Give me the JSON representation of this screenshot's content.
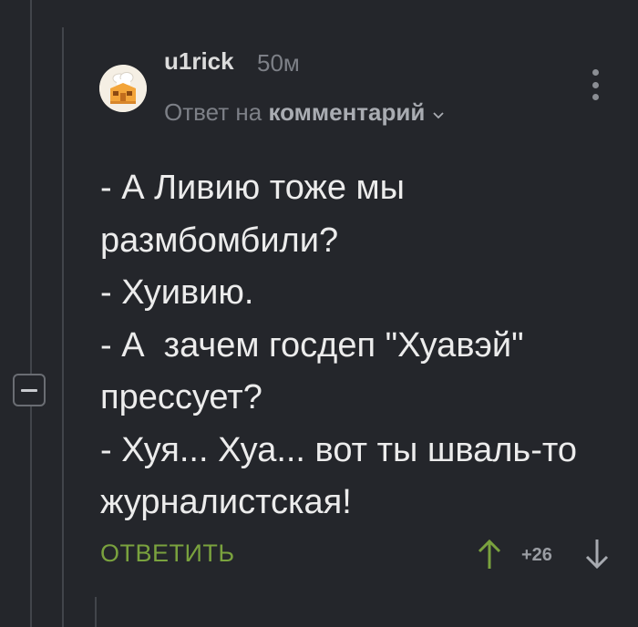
{
  "comment": {
    "author": "u1rick",
    "time_ago": "50м",
    "reply_to_prefix": "Ответ на",
    "reply_to_link": "комментарий",
    "text_lines": [
      "- А Ливию тоже мы",
      "размбомбили?",
      "- Хуивию.",
      "- А  зачем госдеп \"Хуавэй\"",
      "прессует?",
      "- Хуя... Хуа... вот ты шваль-то",
      "журналистская!"
    ],
    "reply_label": "ОТВЕТИТЬ",
    "rating": "+26"
  },
  "icons": {
    "avatar": "avatar-chef-house",
    "collapse": "collapse-minus-icon",
    "more": "more-vertical-icon",
    "reply_chevron": "chevron-down-icon",
    "upvote": "arrow-up-icon",
    "downvote": "arrow-down-icon"
  },
  "colors": {
    "background": "#24262b",
    "reply_button": "#7aa23e",
    "upvote": "#7aa23e",
    "muted": "#7d8087"
  }
}
